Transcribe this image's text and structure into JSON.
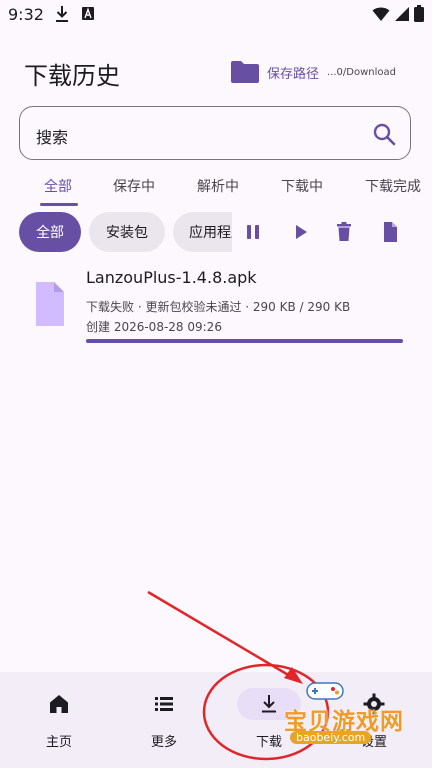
{
  "status_bar": {
    "time": "9:32",
    "icons": [
      "download-icon",
      "a-badge-icon",
      "wifi-icon",
      "signal-icon",
      "battery-icon"
    ]
  },
  "header": {
    "title": "下载历史",
    "save_path_label": "保存路径",
    "save_path_value": "...0/Download"
  },
  "search": {
    "placeholder": "搜索"
  },
  "tabs": [
    "全部",
    "保存中",
    "解析中",
    "下载中",
    "下载完成"
  ],
  "active_tab": "全部",
  "chips": [
    "全部",
    "安装包",
    "应用程序"
  ],
  "active_chip": "全部",
  "actions": [
    "pause-icon",
    "play-icon",
    "delete-icon",
    "file-icon"
  ],
  "downloads": [
    {
      "name": "LanzouPlus-1.4.8.apk",
      "status": "下载失败 · 更新包校验未通过 · 290 KB / 290 KB",
      "created": "创建 2026-08-28 09:26",
      "progress": 1.0
    }
  ],
  "bottom_nav": [
    {
      "label": "主页",
      "icon": "home-icon"
    },
    {
      "label": "更多",
      "icon": "list-icon"
    },
    {
      "label": "下载",
      "icon": "download-icon"
    },
    {
      "label": "设置",
      "icon": "settings-icon"
    }
  ],
  "active_nav": "下载",
  "watermark": {
    "text": "宝贝游戏网",
    "url": "baobeiy.com"
  },
  "colors": {
    "accent": "#6750a4",
    "background": "#fdf8fd",
    "nav_background": "#f3edf7",
    "annotation_red": "#e0262b",
    "watermark_orange": "#f19b26"
  }
}
